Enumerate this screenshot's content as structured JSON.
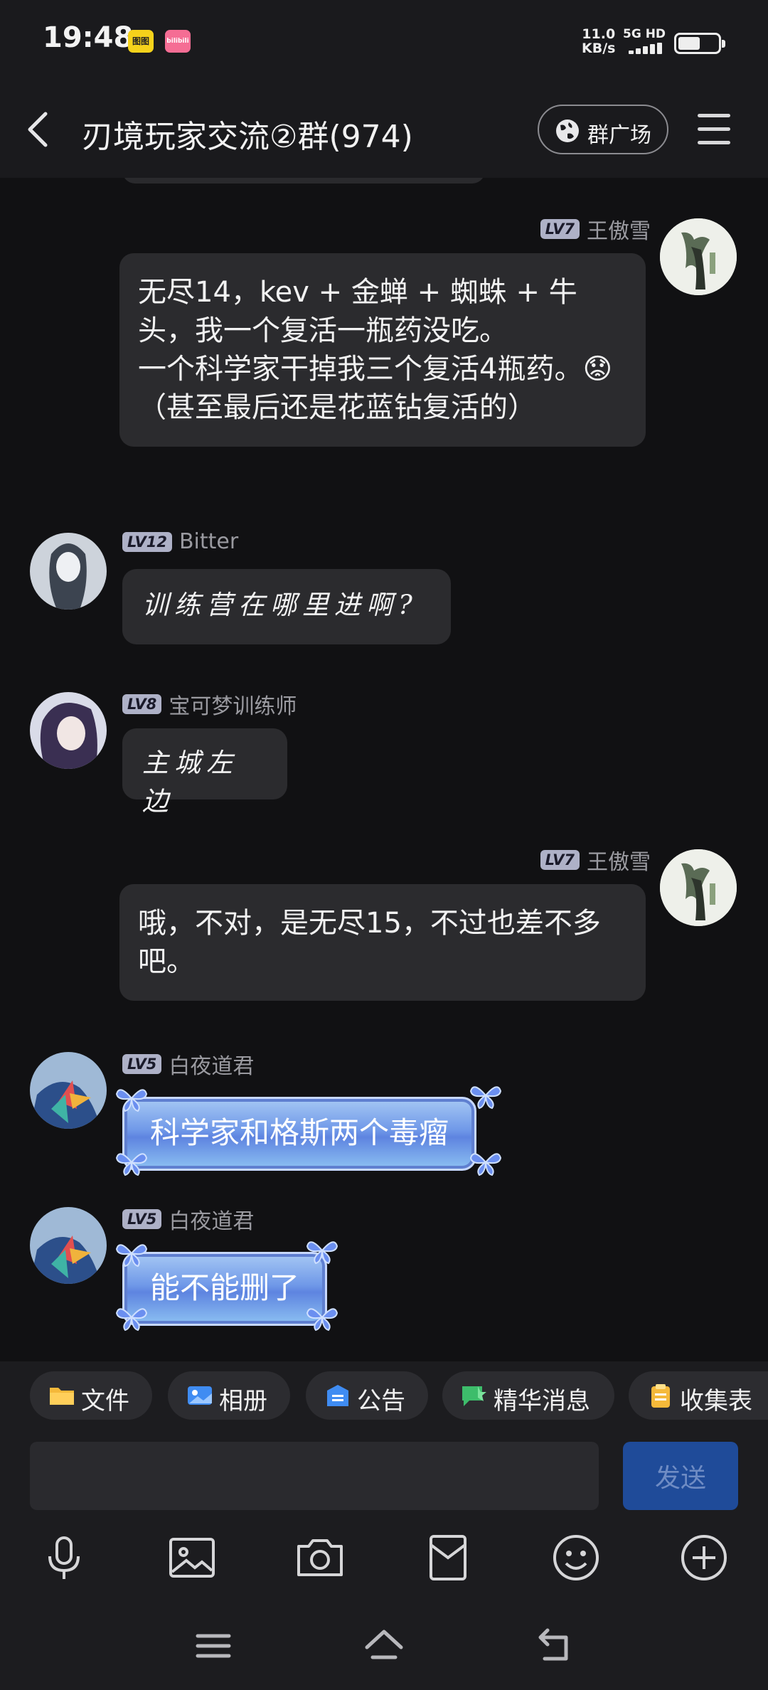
{
  "status_bar": {
    "time": "19:48",
    "app_icons": [
      "图图",
      "bilibili"
    ],
    "net_speed_value": "11.0",
    "net_speed_unit": "KB/s",
    "network_type": "5G HD",
    "battery_percent": 55
  },
  "header": {
    "title": "刃境玩家交流②群(974)",
    "plaza_label": "群广场"
  },
  "messages": [
    {
      "level": "LV7",
      "sender": "王傲雪",
      "side": "right",
      "text": "无尽14，kev + 金蝉 + 蜘蛛 + 牛头，我一个复活一瓶药没吃。\n一个科学家干掉我三个复活4瓶药。😟（甚至最后还是花蓝钻复活的）"
    },
    {
      "level": "LV12",
      "sender": "Bitter",
      "side": "left",
      "text": "训练营在哪里进啊?"
    },
    {
      "level": "LV8",
      "sender": "宝可梦训练师",
      "side": "left",
      "text": "主城左边"
    },
    {
      "level": "LV7",
      "sender": "王傲雪",
      "side": "right",
      "text": "哦，不对，是无尽15，不过也差不多吧。"
    },
    {
      "level": "LV5",
      "sender": "白夜道君",
      "side": "left",
      "text": "科学家和格斯两个毒瘤"
    },
    {
      "level": "LV5",
      "sender": "白夜道君",
      "side": "left",
      "text": "能不能删了"
    }
  ],
  "quick_actions": [
    {
      "label": "文件",
      "icon": "folder-icon"
    },
    {
      "label": "相册",
      "icon": "album-icon"
    },
    {
      "label": "公告",
      "icon": "announcement-icon"
    },
    {
      "label": "精华消息",
      "icon": "essence-icon"
    },
    {
      "label": "收集表",
      "icon": "clipboard-icon"
    }
  ],
  "input": {
    "value": "",
    "send_label": "发送"
  },
  "toolbar_icons": [
    "microphone-icon",
    "image-icon",
    "camera-icon",
    "red-packet-icon",
    "emoji-icon",
    "plus-icon"
  ],
  "nav_icons": [
    "menu-icon",
    "home-icon",
    "back-icon"
  ],
  "colors": {
    "background": "#111113",
    "bubble": "#2b2b2e",
    "send_button": "#1f4b99",
    "level_badge": "#aeb1c7"
  }
}
